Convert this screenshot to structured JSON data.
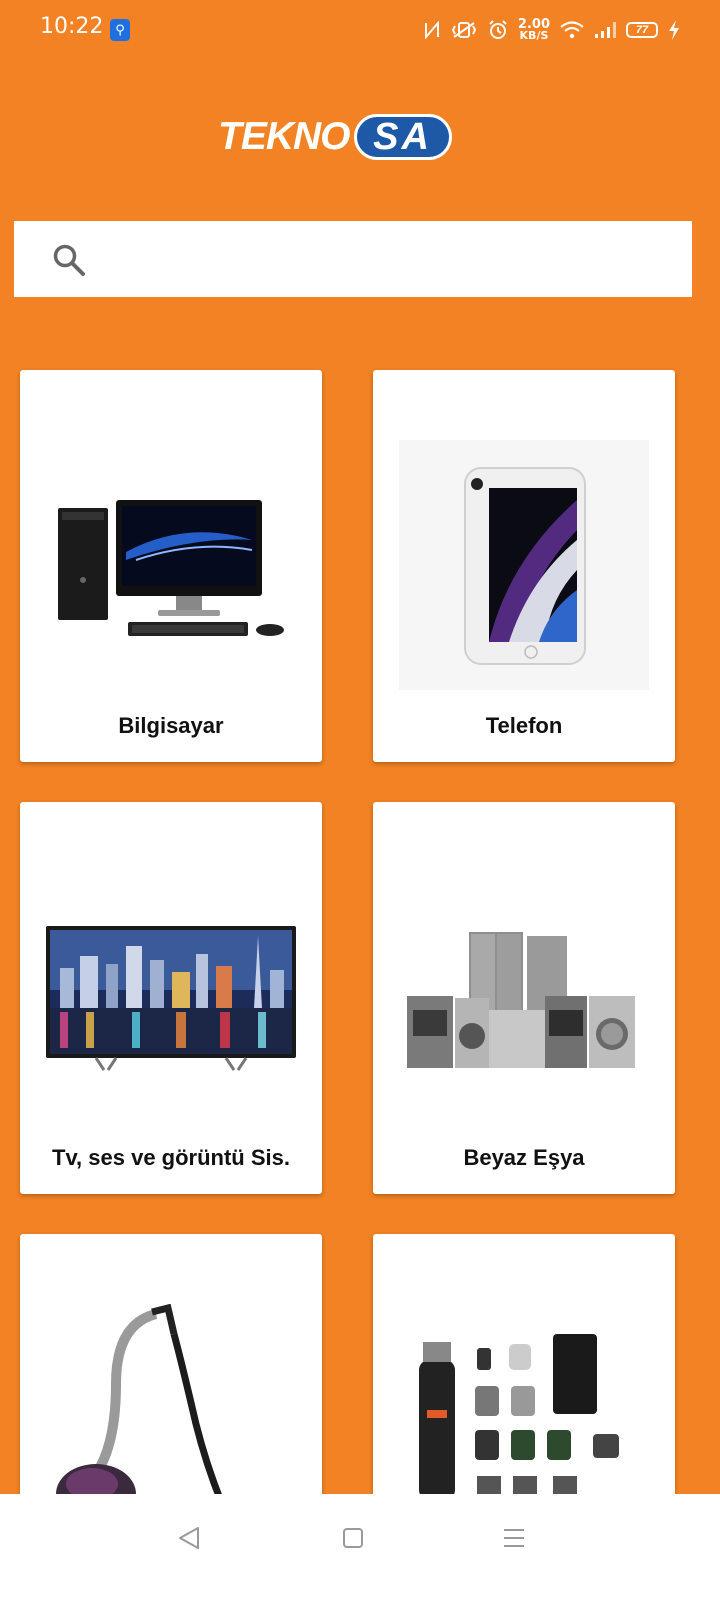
{
  "status_bar": {
    "time": "10:22",
    "speed_value": "2.00",
    "speed_unit": "KB/S",
    "battery": "77",
    "icons": [
      "usb-icon",
      "nfc-icon",
      "vibrate-icon",
      "alarm-icon",
      "wifi-icon",
      "signal-icon",
      "battery-icon",
      "charging-icon"
    ]
  },
  "logo": {
    "main": "TEKNO",
    "accent": "SA"
  },
  "search": {
    "placeholder": "",
    "value": ""
  },
  "categories": [
    {
      "label": "Bilgisayar",
      "icon": "desktop-computer-image"
    },
    {
      "label": "Telefon",
      "icon": "smartphone-image"
    },
    {
      "label": "Tv, ses ve görüntü Sis.",
      "icon": "television-image"
    },
    {
      "label": "Beyaz Eşya",
      "icon": "appliances-image"
    },
    {
      "label": "",
      "icon": "vacuum-cleaner-image"
    },
    {
      "label": "",
      "icon": "grooming-kit-image"
    }
  ],
  "nav_bar": {
    "icons": [
      "back-icon",
      "home-icon",
      "menu-icon"
    ]
  },
  "colors": {
    "background": "#F28223",
    "logo_accent": "#1E59A8",
    "card": "#FFFFFF"
  }
}
